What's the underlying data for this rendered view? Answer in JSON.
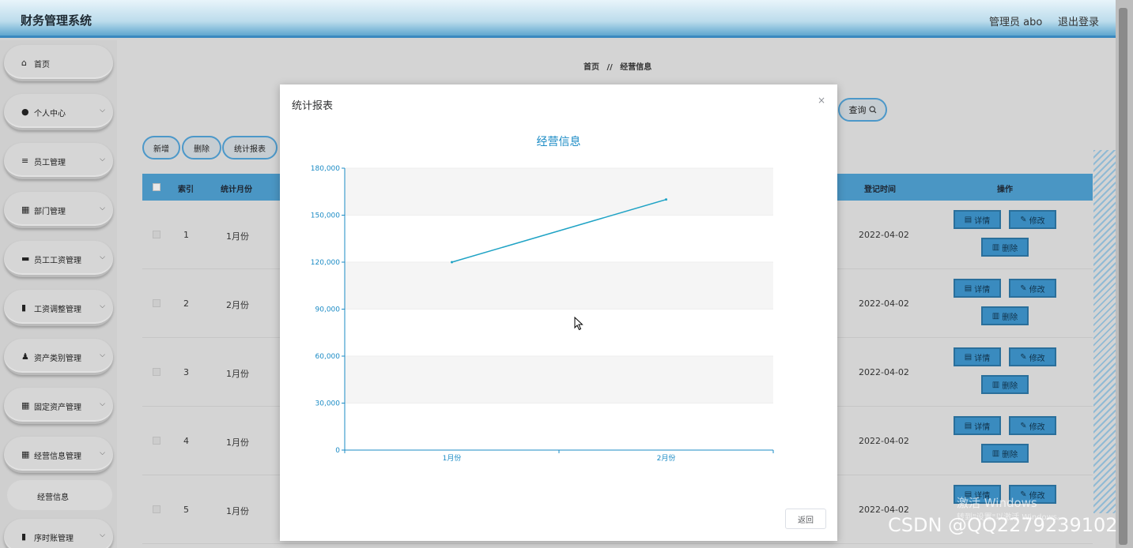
{
  "header": {
    "title": "财务管理系统",
    "user": "管理员 abo",
    "logout": "退出登录"
  },
  "breadcrumb": {
    "home": "首页",
    "sep": "//",
    "current": "经营信息"
  },
  "toolbar": {
    "search": "查询",
    "add": "新增",
    "delete": "删除",
    "report": "统计报表"
  },
  "table": {
    "headers": {
      "index": "索引",
      "month": "统计月份",
      "date": "登记时间",
      "ops": "操作"
    },
    "rows": [
      {
        "index": "1",
        "month": "1月份",
        "date": "2022-04-02"
      },
      {
        "index": "2",
        "month": "2月份",
        "date": "2022-04-02"
      },
      {
        "index": "3",
        "month": "1月份",
        "date": "2022-04-02"
      },
      {
        "index": "4",
        "month": "1月份",
        "date": "2022-04-02"
      },
      {
        "index": "5",
        "month": "1月份",
        "date": "2022-04-02"
      }
    ],
    "op_labels": {
      "detail": "详情",
      "edit": "修改",
      "delete": "删除"
    }
  },
  "sidebar": {
    "items": [
      {
        "label": "首页",
        "icon": "home-icon"
      },
      {
        "label": "个人中心",
        "icon": "user-icon"
      },
      {
        "label": "员工管理",
        "icon": "list-icon"
      },
      {
        "label": "部门管理",
        "icon": "grid-icon"
      },
      {
        "label": "员工工资管理",
        "icon": "monitor-icon"
      },
      {
        "label": "工资调整管理",
        "icon": "chart-icon"
      },
      {
        "label": "资产类别管理",
        "icon": "person-icon"
      },
      {
        "label": "固定资产管理",
        "icon": "grid-icon"
      },
      {
        "label": "经营信息管理",
        "icon": "grid-icon"
      },
      {
        "label": "序时账管理",
        "icon": "doc-icon"
      }
    ],
    "sub_item": "经营信息"
  },
  "modal": {
    "title": "统计报表",
    "close": "×",
    "return": "返回"
  },
  "chart_data": {
    "type": "line",
    "title": "经营信息",
    "categories": [
      "1月份",
      "2月份"
    ],
    "series": [
      {
        "values": [
          120000,
          160000
        ]
      }
    ],
    "ylim": [
      0,
      180000
    ],
    "yticks": [
      "0",
      "30,000",
      "60,000",
      "90,000",
      "120,000",
      "150,000",
      "180,000"
    ],
    "color": "#1fa3c5",
    "grid": "alternating horizontal bands"
  },
  "watermarks": {
    "windows": "激活 Windows",
    "windows_sub": "转到\"设置\"以激活 Windows。",
    "csdn": "CSDN @QQ2279239102"
  }
}
